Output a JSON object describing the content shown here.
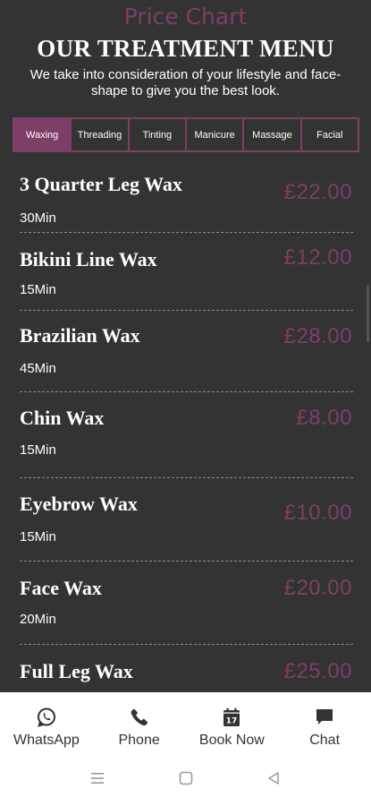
{
  "header": {
    "kicker": "Price Chart",
    "title": "OUR TREATMENT MENU",
    "subtitle": "We take into consideration of your lifestyle and face-shape to give you the best look."
  },
  "tabs": [
    {
      "label": "Waxing",
      "active": true
    },
    {
      "label": "Threading",
      "active": false
    },
    {
      "label": "Tinting",
      "active": false
    },
    {
      "label": "Manicure",
      "active": false
    },
    {
      "label": "Massage",
      "active": false
    },
    {
      "label": "Facial",
      "active": false
    }
  ],
  "treatments": [
    {
      "name": "3 Quarter Leg Wax",
      "duration": "30Min",
      "price": "£22.00"
    },
    {
      "name": "Bikini Line Wax",
      "duration": "15Min",
      "price": "£12.00"
    },
    {
      "name": "Brazilian Wax",
      "duration": "45Min",
      "price": "£28.00"
    },
    {
      "name": "Chin Wax",
      "duration": "15Min",
      "price": "£8.00"
    },
    {
      "name": "Eyebrow Wax",
      "duration": "15Min",
      "price": "£10.00"
    },
    {
      "name": "Face Wax",
      "duration": "20Min",
      "price": "£20.00"
    },
    {
      "name": "Full Leg Wax",
      "duration": "",
      "price": "£25.00"
    }
  ],
  "bottom_nav": [
    {
      "label": "WhatsApp",
      "icon": "whatsapp-icon"
    },
    {
      "label": "Phone",
      "icon": "phone-icon"
    },
    {
      "label": "Book Now",
      "icon": "calendar-icon",
      "icon_text": "17"
    },
    {
      "label": "Chat",
      "icon": "chat-icon"
    }
  ],
  "system_nav": [
    {
      "icon": "menu-icon"
    },
    {
      "icon": "home-icon"
    },
    {
      "icon": "back-icon"
    }
  ],
  "colors": {
    "background": "#333333",
    "accent": "#7d3f66",
    "text": "#ffffff",
    "nav_background": "#ffffff"
  }
}
